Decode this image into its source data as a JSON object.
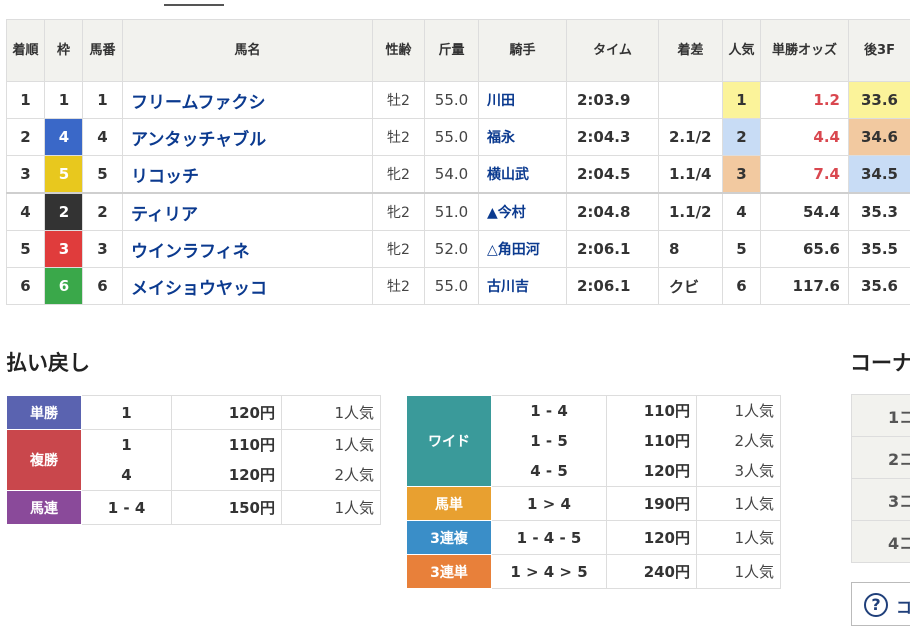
{
  "headers": {
    "rank": "着順",
    "waku": "枠",
    "umaban": "馬番",
    "horse": "馬名",
    "sexage": "性齢",
    "weight": "斤量",
    "jockey": "騎手",
    "time": "タイム",
    "margin": "着差",
    "pop": "人気",
    "odds": "単勝オッズ",
    "agari": "後3F"
  },
  "rows": [
    {
      "rank": "1",
      "waku": "1",
      "umaban": "1",
      "horse": "フリームファクシ",
      "sexage": "牡2",
      "weight": "55.0",
      "jockey": "川田",
      "time": "2:03.9",
      "margin": "",
      "pop": "1",
      "odds": "1.2",
      "agari": "33.6"
    },
    {
      "rank": "2",
      "waku": "4",
      "umaban": "4",
      "horse": "アンタッチャブル",
      "sexage": "牡2",
      "weight": "55.0",
      "jockey": "福永",
      "time": "2:04.3",
      "margin": "2.1/2",
      "pop": "2",
      "odds": "4.4",
      "agari": "34.6"
    },
    {
      "rank": "3",
      "waku": "5",
      "umaban": "5",
      "horse": "リコッチ",
      "sexage": "牝2",
      "weight": "54.0",
      "jockey": "横山武",
      "time": "2:04.5",
      "margin": "1.1/4",
      "pop": "3",
      "odds": "7.4",
      "agari": "34.5"
    },
    {
      "rank": "4",
      "waku": "2",
      "umaban": "2",
      "horse": "ティリア",
      "sexage": "牝2",
      "weight": "51.0",
      "jockey": "▲今村",
      "time": "2:04.8",
      "margin": "1.1/2",
      "pop": "4",
      "odds": "54.4",
      "agari": "35.3"
    },
    {
      "rank": "5",
      "waku": "3",
      "umaban": "3",
      "horse": "ウインラフィネ",
      "sexage": "牝2",
      "weight": "52.0",
      "jockey": "△角田河",
      "time": "2:06.1",
      "margin": "8",
      "pop": "5",
      "odds": "65.6",
      "agari": "35.5"
    },
    {
      "rank": "6",
      "waku": "6",
      "umaban": "6",
      "horse": "メイショウヤッコ",
      "sexage": "牡2",
      "weight": "55.0",
      "jockey": "古川吉",
      "time": "2:06.1",
      "margin": "クビ",
      "pop": "6",
      "odds": "117.6",
      "agari": "35.6"
    }
  ],
  "waku_colors": {
    "1": "#ffffff",
    "2": "#333333",
    "3": "#e03c3c",
    "4": "#3a68c8",
    "5": "#e8c81e",
    "6": "#3aa84a"
  },
  "waku_text_colors": {
    "1": "#333333",
    "2": "#ffffff",
    "3": "#ffffff",
    "4": "#ffffff",
    "5": "#ffffff",
    "6": "#ffffff"
  },
  "highlight_colors": {
    "first": "#fbf39a",
    "second": "#c8dcf5",
    "third": "#f2c9a0"
  },
  "payout_title": "払い戻し",
  "corner_title": "コーナ",
  "payout_left": [
    {
      "label": "単勝",
      "color": "#5a63b0",
      "items": [
        {
          "combo": "1",
          "amount": "120円",
          "pop": "1人気"
        }
      ]
    },
    {
      "label": "複勝",
      "color": "#c9474c",
      "items": [
        {
          "combo": "1",
          "amount": "110円",
          "pop": "1人気"
        },
        {
          "combo": "4",
          "amount": "120円",
          "pop": "2人気"
        }
      ]
    },
    {
      "label": "馬連",
      "color": "#8a4a9a",
      "items": [
        {
          "combo": "1 - 4",
          "amount": "150円",
          "pop": "1人気"
        }
      ]
    }
  ],
  "payout_right": [
    {
      "label": "ワイド",
      "color": "#3a9a9a",
      "items": [
        {
          "combo": "1 - 4",
          "amount": "110円",
          "pop": "1人気"
        },
        {
          "combo": "1 - 5",
          "amount": "110円",
          "pop": "2人気"
        },
        {
          "combo": "4 - 5",
          "amount": "120円",
          "pop": "3人気"
        }
      ]
    },
    {
      "label": "馬単",
      "color": "#e8a030",
      "items": [
        {
          "combo": "1 > 4",
          "amount": "190円",
          "pop": "1人気"
        }
      ]
    },
    {
      "label": "3連複",
      "color": "#3a8ec8",
      "items": [
        {
          "combo": "1 - 4 - 5",
          "amount": "120円",
          "pop": "1人気"
        }
      ]
    },
    {
      "label": "3連単",
      "color": "#e8803a",
      "items": [
        {
          "combo": "1 > 4 > 5",
          "amount": "240円",
          "pop": "1人気"
        }
      ]
    }
  ],
  "corner_rows": [
    "1コ",
    "2コ",
    "3コ",
    "4コ"
  ],
  "help_label": "コ"
}
